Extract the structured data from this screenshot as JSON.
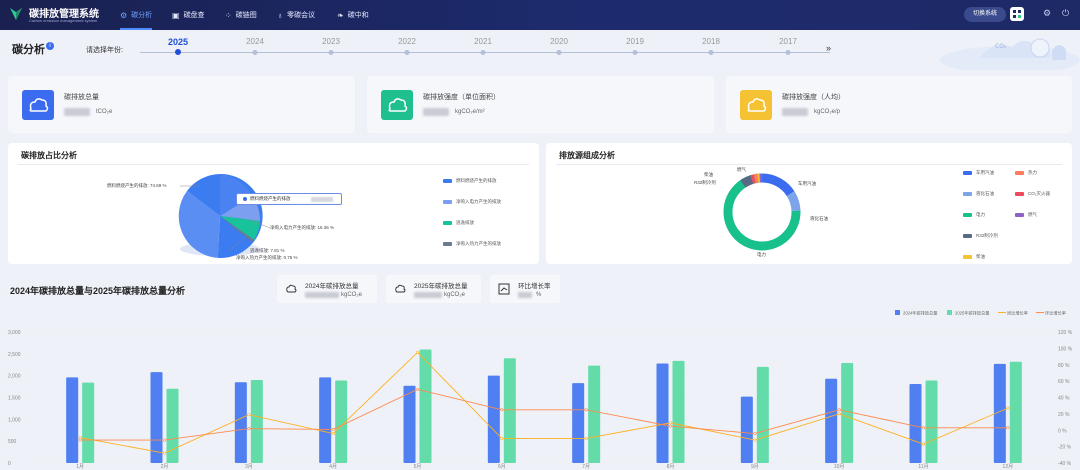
{
  "app": {
    "title": "碳排放管理系统",
    "subtitle": "Carbon emission management system"
  },
  "nav": [
    {
      "label": "碳分析",
      "icon": "gear-icon",
      "active": true
    },
    {
      "label": "碳盘查",
      "icon": "image-icon",
      "active": false
    },
    {
      "label": "碳链图",
      "icon": "nodes-icon",
      "active": false
    },
    {
      "label": "零碳会议",
      "icon": "microphone-icon",
      "active": false
    },
    {
      "label": "碳中和",
      "icon": "leaf-icon",
      "active": false
    }
  ],
  "header_right": {
    "switch_label": "切换系统",
    "icons": [
      "apps-icon",
      "settings-icon",
      "power-icon"
    ]
  },
  "page": {
    "title": "碳分析",
    "year_prompt": "请选择年份:"
  },
  "years": [
    "2025",
    "2024",
    "2023",
    "2022",
    "2021",
    "2020",
    "2019",
    "2018",
    "2017"
  ],
  "selected_year": "2025",
  "stats": [
    {
      "title": "碳排放总量",
      "unit": "tCO₂e",
      "color": "#3b6cf0"
    },
    {
      "title": "碳排放强度（单位面积）",
      "unit": "kgCO₂e/m²",
      "color": "#1fbf8f"
    },
    {
      "title": "碳排放强度（人均）",
      "unit": "kgCO₂e/p",
      "color": "#f5c233"
    }
  ],
  "share_panel": {
    "title": "碳排放占比分析",
    "labels": {
      "fuel": "燃料燃烧产生的排放: 74.69 %",
      "purchased": "净购入电力产生的排放: 16.36 %",
      "escape": "逃逸排放: 7.81 %",
      "heat": "净购入热力产生的排放: 0.75 %"
    },
    "tooltip": "燃料燃烧产生的排放",
    "legend": [
      {
        "label": "燃料燃烧产生的排放",
        "color": "#3b7cf0"
      },
      {
        "label": "净购入电力产生的排放",
        "color": "#7d9ff0"
      },
      {
        "label": "逃逸排放",
        "color": "#18c29a"
      },
      {
        "label": "净购入热力产生的排放",
        "color": "#6b7a90"
      }
    ]
  },
  "source_panel": {
    "title": "排放源组成分析",
    "labels": {
      "diesel": "柴油",
      "r32": "R32制冷剂",
      "gas": "燃气",
      "gasoline": "车用汽油",
      "lpg": "液化石油",
      "power": "电力"
    },
    "legend": [
      {
        "label": "车用汽油",
        "color": "#3b6cf0"
      },
      {
        "label": "热力",
        "color": "#ff7d5c"
      },
      {
        "label": "液化石油",
        "color": "#7da3ea"
      },
      {
        "label": "CO₂灭火器",
        "color": "#ef4b5e"
      },
      {
        "label": "电力",
        "color": "#18c08c"
      },
      {
        "label": "燃气",
        "color": "#8a63c9"
      },
      {
        "label": "R32制冷剂",
        "color": "#5a6a84"
      },
      {
        "label": "柴油",
        "color": "#f5c233"
      }
    ]
  },
  "compare": {
    "title": "2024年碳排放总量与2025年碳排放总量分析",
    "cards": [
      {
        "title": "2024年碳排放总量",
        "unit": "kgCO₂e"
      },
      {
        "title": "2025年碳排放总量",
        "unit": "kgCO₂e"
      },
      {
        "title": "环比增长率",
        "unit": "%"
      }
    ]
  },
  "chart_data": {
    "type": "bar",
    "categories": [
      "1月",
      "2月",
      "3月",
      "4月",
      "5月",
      "6月",
      "7月",
      "8月",
      "9月",
      "10月",
      "11月",
      "12月"
    ],
    "series": [
      {
        "name": "2024年碳排放总量",
        "type": "bar",
        "axis": "left",
        "color": "#4f7ff0",
        "values": [
          1960,
          2080,
          1850,
          1960,
          1770,
          2000,
          1830,
          2280,
          1520,
          1930,
          1810,
          2270
        ]
      },
      {
        "name": "2025年碳排放总量",
        "type": "bar",
        "axis": "left",
        "color": "#63dcaa",
        "values": [
          1840,
          1700,
          1900,
          1890,
          2600,
          2400,
          2230,
          2340,
          2200,
          2290,
          1890,
          2320
        ]
      },
      {
        "name": "同比增长率",
        "type": "line",
        "axis": "right",
        "color": "#ffb020",
        "values": [
          -9,
          -28,
          19,
          -4,
          95,
          -10,
          -10,
          9,
          -12,
          20,
          -17,
          27
        ]
      },
      {
        "name": "环比增长率",
        "type": "line",
        "axis": "right",
        "color": "#ff8a4c",
        "values": [
          -12,
          -12,
          2,
          1,
          50,
          25,
          25,
          5,
          -4,
          25,
          3,
          3
        ]
      }
    ],
    "y_left": {
      "min": 0,
      "max": 3000,
      "ticks": [
        "0",
        "500",
        "1,000",
        "1,500",
        "2,000",
        "2,500",
        "3,000"
      ]
    },
    "y_right": {
      "min": -40,
      "max": 120,
      "ticks": [
        "-40 %",
        "-20 %",
        "0 %",
        "20 %",
        "40 %",
        "60 %",
        "80 %",
        "100 %",
        "120 %"
      ]
    },
    "legend_position": "top-right",
    "grid": true
  }
}
